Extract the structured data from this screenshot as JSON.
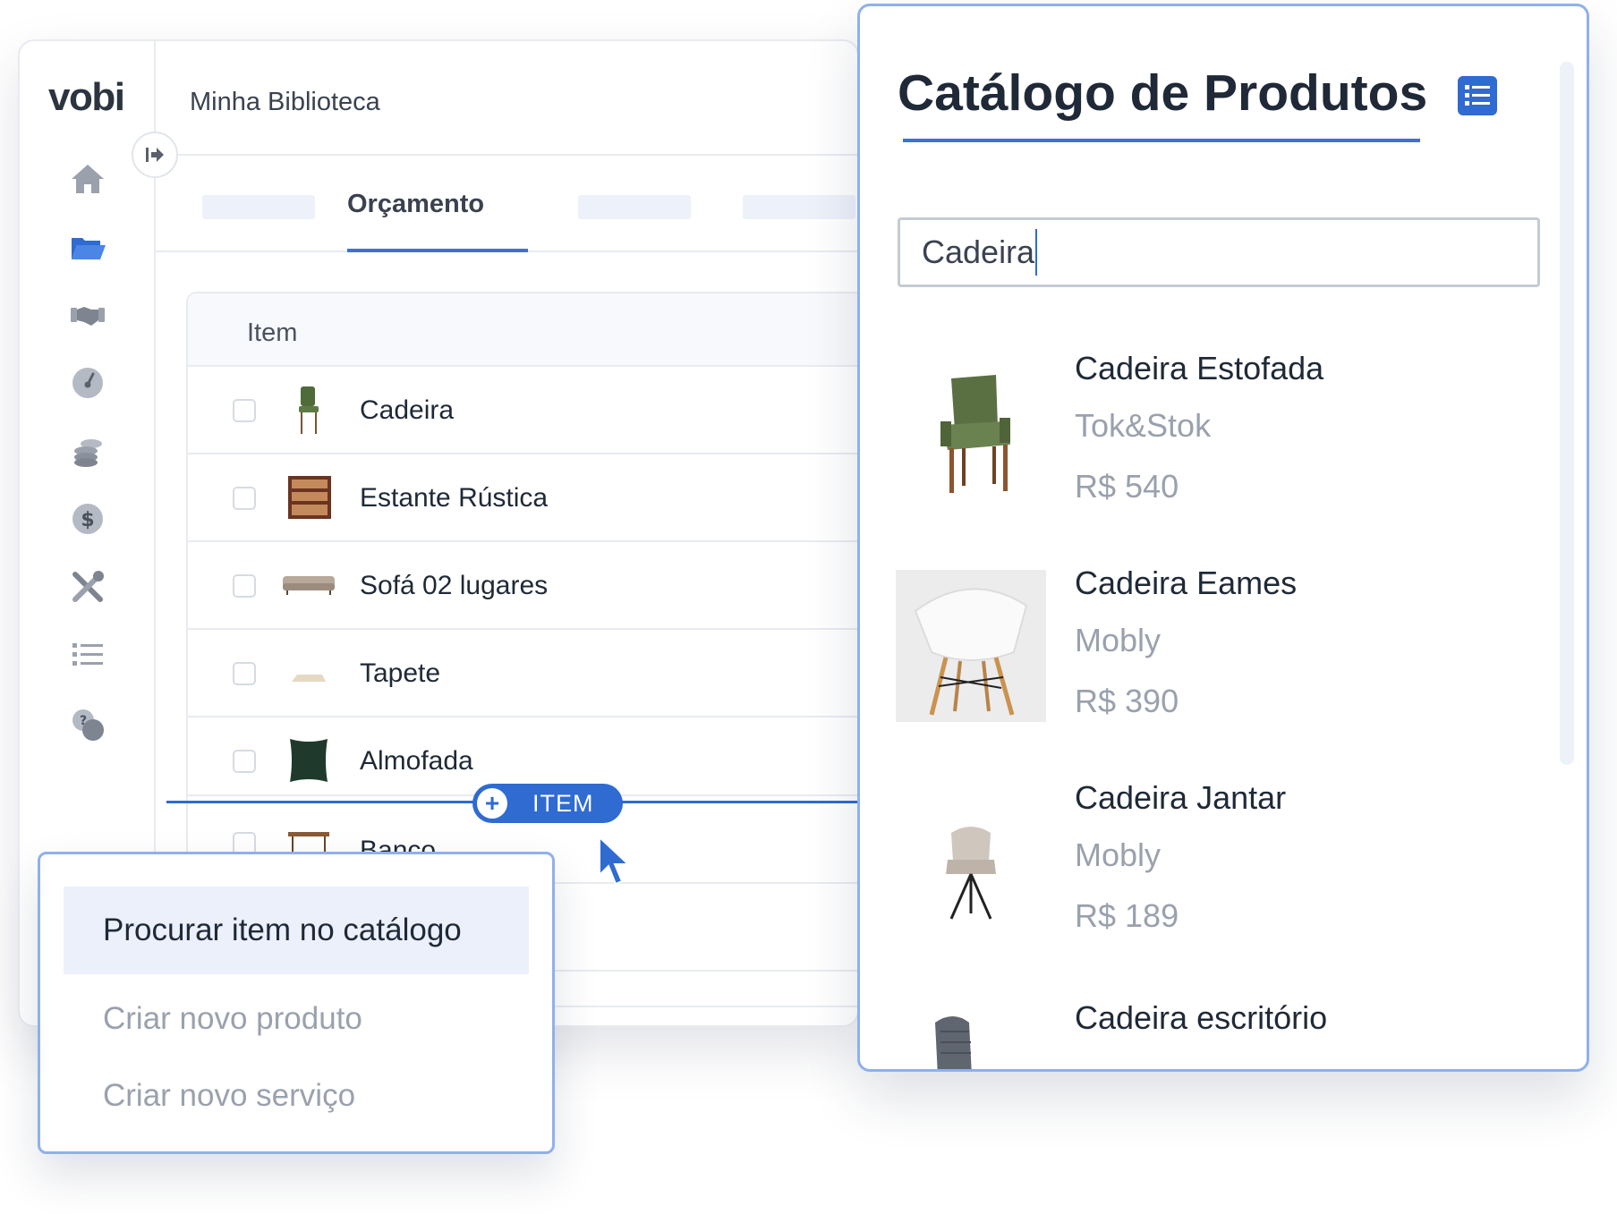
{
  "app": {
    "logo": "vobi",
    "breadcrumb": "Minha Biblioteca",
    "active_tab": "Orçamento",
    "sidebar_icons": [
      "home-icon",
      "folder-icon",
      "handshake-icon",
      "gauge-icon",
      "coins-icon",
      "dollar-icon",
      "tools-icon",
      "list-icon",
      "help-chat-icon"
    ],
    "table": {
      "column_header": "Item",
      "rows": [
        {
          "label": "Cadeira",
          "icon": "chair-thumb"
        },
        {
          "label": "Estante Rústica",
          "icon": "shelf-thumb"
        },
        {
          "label": "Sofá 02 lugares",
          "icon": "sofa-thumb"
        },
        {
          "label": "Tapete",
          "icon": "rug-thumb"
        },
        {
          "label": "Almofada",
          "icon": "cushion-thumb"
        },
        {
          "label": "Banco",
          "icon": "bench-thumb"
        }
      ]
    },
    "insert_button": {
      "symbol": "+",
      "label": "ITEM"
    }
  },
  "menu": {
    "items": [
      {
        "label": "Procurar item no catálogo",
        "active": true
      },
      {
        "label": "Criar novo produto",
        "active": false
      },
      {
        "label": "Criar novo serviço",
        "active": false
      }
    ]
  },
  "catalog": {
    "title": "Catálogo de Produtos",
    "search_value": "Cadeira",
    "products": [
      {
        "name": "Cadeira Estofada",
        "brand": "Tok&Stok",
        "price": "R$ 540"
      },
      {
        "name": "Cadeira Eames",
        "brand": "Mobly",
        "price": "R$ 390"
      },
      {
        "name": "Cadeira Jantar",
        "brand": "Mobly",
        "price": "R$ 189"
      },
      {
        "name": "Cadeira escritório",
        "brand": "",
        "price": ""
      }
    ]
  },
  "colors": {
    "accent": "#2f6bd1",
    "panel_border": "#8fb0ec",
    "muted_text": "#9aa1ad"
  }
}
